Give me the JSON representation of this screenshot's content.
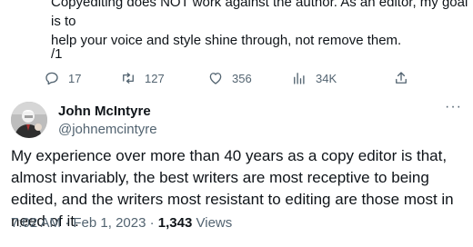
{
  "previous_tweet": {
    "text_lines": [
      "Copyediting does NOT work against the author. As an editor, my goal is to",
      "help your voice and style shine through, not remove them."
    ],
    "thread_marker": "/1",
    "actions": {
      "replies": "17",
      "retweets": "127",
      "likes": "356",
      "views": "34K"
    }
  },
  "reply": {
    "author_name": "John McIntyre",
    "author_handle": "@johnemcintyre",
    "more_label": "···",
    "body": "My experience over more than 40 years as a copy editor is that, almost invariably, the best writers are most receptive to being edited, and the writers most resistant to editing are those most in need of it.",
    "time": "7:02 AM",
    "separator": "·",
    "date": "Feb 1, 2023",
    "views_count": "1,343",
    "views_label": "Views"
  },
  "colors": {
    "text": "#0f1419",
    "secondary": "#536471"
  },
  "icons": [
    "reply-icon",
    "retweet-icon",
    "like-icon",
    "views-icon",
    "share-icon"
  ]
}
